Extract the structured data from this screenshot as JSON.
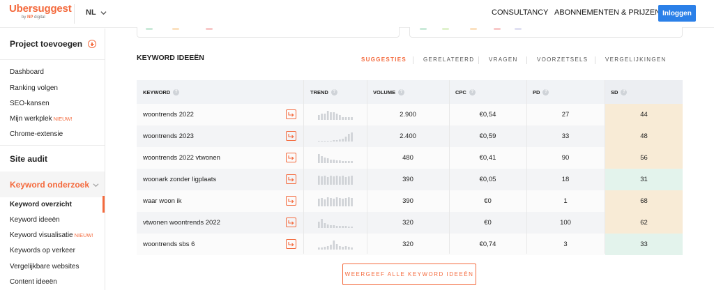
{
  "header": {
    "logo_text": "Ubersuggest",
    "logo_by": "by",
    "logo_np": "NP",
    "logo_digital": "digital",
    "language": "NL",
    "nav_consultancy": "CONSULTANCY",
    "nav_pricing": "ABONNEMENTEN & PRIJZEN",
    "login": "Inloggen"
  },
  "sidebar": {
    "add_project": "Project toevoegen",
    "items": [
      {
        "label": "Dashboard"
      },
      {
        "label": "Ranking volgen"
      },
      {
        "label": "SEO-kansen"
      },
      {
        "label": "Mijn werkplek",
        "badge": "NIEUW!"
      },
      {
        "label": "Chrome-extensie"
      }
    ],
    "site_audit": "Site audit",
    "keyword_research": "Keyword onderzoek",
    "sub_items": [
      {
        "label": "Keyword overzicht"
      },
      {
        "label": "Keyword ideeën"
      },
      {
        "label": "Keyword visualisatie",
        "badge": "NIEUW!"
      },
      {
        "label": "Keywords op verkeer"
      },
      {
        "label": "Vergelijkbare websites"
      },
      {
        "label": "Content ideeën"
      }
    ]
  },
  "main": {
    "section_title": "KEYWORD IDEEËN",
    "tabs": [
      "SUGGESTIES",
      "GERELATEERD",
      "VRAGEN",
      "VOORZETSELS",
      "VERGELIJKINGEN"
    ],
    "columns": [
      "KEYWORD",
      "TREND",
      "VOLUME",
      "CPC",
      "PD",
      "SD"
    ],
    "rows": [
      {
        "keyword": "woontrends 2022",
        "volume": "2.900",
        "cpc": "€0,54",
        "pd": "27",
        "sd": "44",
        "sd_color": "#f8ebd6",
        "trend": [
          3,
          4,
          4,
          6,
          5,
          5,
          4,
          3,
          2,
          2,
          2,
          2
        ]
      },
      {
        "keyword": "woontrends 2023",
        "volume": "2.400",
        "cpc": "€0,59",
        "pd": "33",
        "sd": "48",
        "sd_color": "#f8ebd6",
        "trend": [
          1,
          1,
          1,
          1,
          1,
          2,
          2,
          3,
          4,
          6,
          10,
          12
        ]
      },
      {
        "keyword": "woontrends 2022 vtwonen",
        "volume": "480",
        "cpc": "€0,41",
        "pd": "90",
        "sd": "56",
        "sd_color": "#f8ebd6",
        "trend": [
          10,
          8,
          6,
          5,
          4,
          4,
          3,
          3,
          2,
          2,
          2,
          2
        ]
      },
      {
        "keyword": "woonark zonder ligplaats",
        "volume": "390",
        "cpc": "€0,05",
        "pd": "18",
        "sd": "31",
        "sd_color": "#e3f3ec",
        "trend": [
          12,
          11,
          12,
          10,
          12,
          11,
          12,
          11,
          12,
          10,
          11,
          12
        ]
      },
      {
        "keyword": "waar woon ik",
        "volume": "390",
        "cpc": "€0",
        "pd": "1",
        "sd": "68",
        "sd_color": "#f8ebd6",
        "trend": [
          10,
          11,
          9,
          12,
          11,
          10,
          12,
          11,
          10,
          11,
          12,
          11
        ]
      },
      {
        "keyword": "vtwonen woontrends 2022",
        "volume": "320",
        "cpc": "€0",
        "pd": "100",
        "sd": "62",
        "sd_color": "#f8ebd6",
        "trend": [
          8,
          12,
          6,
          5,
          4,
          4,
          3,
          3,
          3,
          3,
          2,
          2
        ]
      },
      {
        "keyword": "woontrends sbs 6",
        "volume": "320",
        "cpc": "€0,74",
        "pd": "3",
        "sd": "33",
        "sd_color": "#e3f3ec",
        "trend": [
          2,
          2,
          3,
          4,
          5,
          10,
          6,
          4,
          3,
          4,
          3,
          2
        ]
      }
    ],
    "show_all": "WEERGEEF ALLE KEYWORD IDEEËN"
  },
  "colors": {
    "accent": "#f46a3d",
    "login": "#2b80e8"
  }
}
